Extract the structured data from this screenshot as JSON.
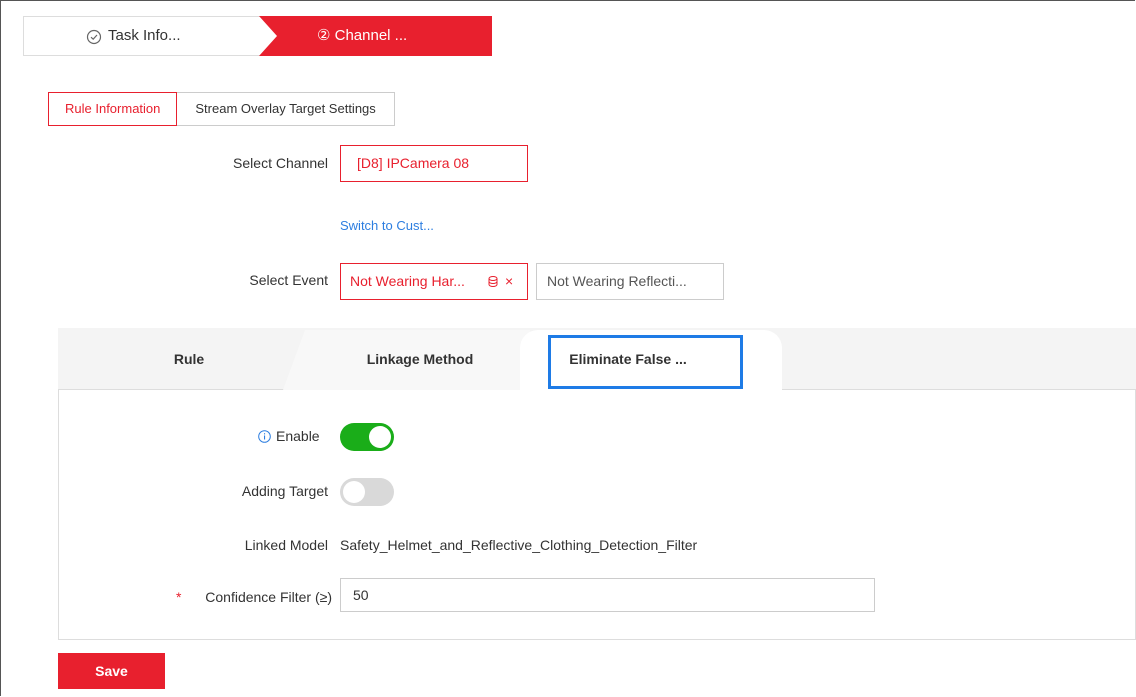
{
  "stepper": {
    "step1_label": "Task Info...",
    "step2_label": "② Channel ..."
  },
  "subtabs": [
    {
      "label": "Rule Information"
    },
    {
      "label": "Stream Overlay Target Settings"
    }
  ],
  "form": {
    "select_channel_label": "Select Channel",
    "selected_channel": "[D8] IPCamera 08",
    "switch_link": "Switch to Cust...",
    "select_event_label": "Select Event",
    "event_selected": "Not Wearing Har...",
    "event_other": "Not Wearing Reflecti..."
  },
  "panel_tabs": [
    {
      "label": "Rule"
    },
    {
      "label": "Linkage Method"
    },
    {
      "label": "Eliminate False ..."
    }
  ],
  "settings": {
    "enable_label": "Enable",
    "enable_on": true,
    "adding_target_label": "Adding Target",
    "adding_target_on": false,
    "linked_model_label": "Linked Model",
    "linked_model_value": "Safety_Helmet_and_Reflective_Clothing_Detection_Filter",
    "required_mark": "*",
    "confidence_label": "Confidence Filter (≥)",
    "confidence_value": "50"
  },
  "save_label": "Save",
  "colors": {
    "accent_red": "#e8202e",
    "toggle_on": "#1aad19",
    "toggle_off": "#d9d9d9",
    "link_blue": "#2d7ee0",
    "focus_blue": "#1e7be6"
  }
}
